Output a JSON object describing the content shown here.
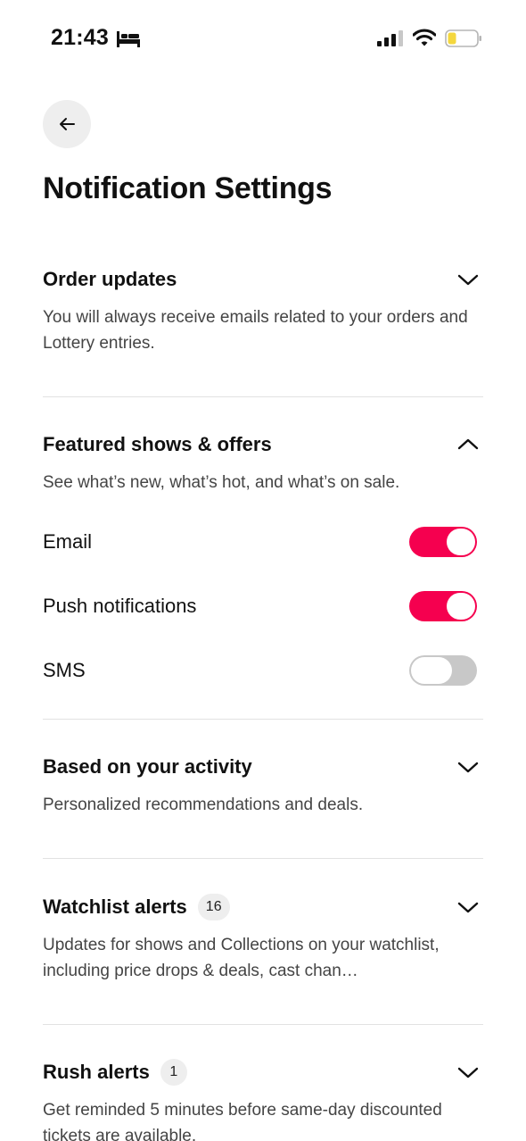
{
  "status_bar": {
    "time": "21:43",
    "icons": [
      "bed-icon",
      "signal-icon",
      "wifi-icon",
      "battery-icon"
    ],
    "battery_color": "#f4d73e"
  },
  "header": {
    "back_icon": "arrow-left-icon",
    "title": "Notification Settings"
  },
  "colors": {
    "accent": "#f5004f",
    "toggle_off": "#c8c8c8"
  },
  "sections": [
    {
      "title": "Order updates",
      "description": "You will always receive emails related to your orders and Lottery entries.",
      "expanded": false
    },
    {
      "title": "Featured shows & offers",
      "description": "See what’s new, what’s hot, and what’s on sale.",
      "expanded": true,
      "toggles": [
        {
          "label": "Email",
          "on": true
        },
        {
          "label": "Push notifications",
          "on": true
        },
        {
          "label": "SMS",
          "on": false
        }
      ]
    },
    {
      "title": "Based on your activity",
      "description": "Personalized recommendations and deals.",
      "expanded": false
    },
    {
      "title": "Watchlist alerts",
      "badge": "16",
      "description": "Updates for shows and Collections on your watchlist, including price drops & deals, cast chan…",
      "expanded": false
    },
    {
      "title": "Rush alerts",
      "badge": "1",
      "description": "Get reminded 5 minutes before same-day discounted tickets are available.",
      "expanded": false
    }
  ]
}
